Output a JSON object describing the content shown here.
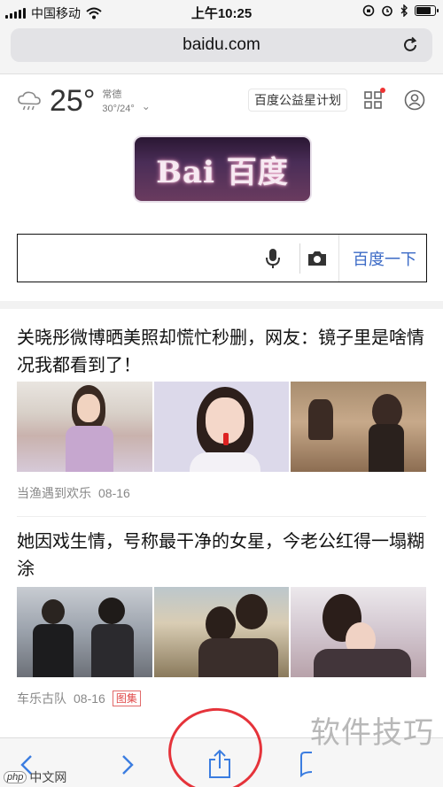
{
  "status_bar": {
    "carrier": "中国移动",
    "time": "上午10:25",
    "battery_level": 0.85,
    "icons": [
      "signal-icon",
      "wifi-icon",
      "rotation-lock-icon",
      "alarm-icon",
      "bluetooth-icon",
      "battery-icon"
    ]
  },
  "browser": {
    "url": "baidu.com"
  },
  "weather": {
    "temperature": "25°",
    "condition": "常德",
    "range": "30°/24°"
  },
  "header": {
    "charity_label": "百度公益星计划"
  },
  "logo": {
    "text": "Bai 百度"
  },
  "search": {
    "placeholder": "",
    "button_label": "百度一下"
  },
  "feed": [
    {
      "title": "关晓彤微博晒美照却慌忙秒删，网友：镜子里是啥情况我都看到了！",
      "source": "当渔遇到欢乐",
      "date": "08-16",
      "badge": ""
    },
    {
      "title": "她因戏生情，号称最干净的女星，今老公红得一塌糊涂",
      "source": "车乐古队",
      "date": "08-16",
      "badge": "图集"
    }
  ],
  "watermark": {
    "text": "软件技巧",
    "site": "中文网",
    "site_logo": "php"
  },
  "colors": {
    "search_button": "#3b6ac6",
    "highlight_circle": "#e5333a",
    "badge": "#e04a4a"
  }
}
